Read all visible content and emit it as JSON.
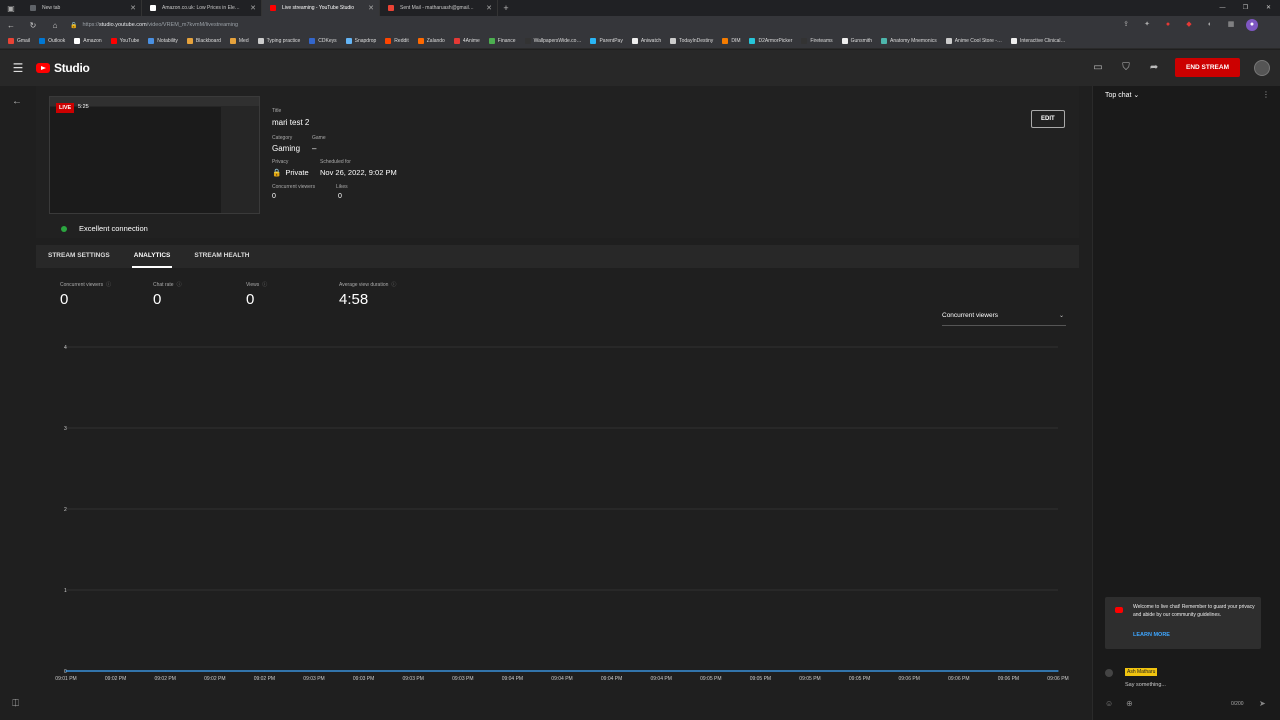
{
  "browser": {
    "tabs": [
      {
        "label": "New tab",
        "color": "#5f6368"
      },
      {
        "label": "Amazon.co.uk: Low Prices in Ele…",
        "color": "#ffffff"
      },
      {
        "label": "Live streaming - YouTube Studio",
        "color": "#ff0000"
      },
      {
        "label": "Sent Mail - matharuash@gmail…",
        "color": "#ea4335"
      }
    ],
    "active_tab": 2,
    "url_host": "studio.youtube.com",
    "url_prefix": "https://",
    "url_path": "/video/VREM_m7kvmM/livestreaming",
    "bookmarks": [
      {
        "label": "Gmail",
        "color": "#ea4335"
      },
      {
        "label": "Outlook",
        "color": "#0078d4"
      },
      {
        "label": "Amazon",
        "color": "#ffffff"
      },
      {
        "label": "YouTube",
        "color": "#ff0000"
      },
      {
        "label": "Notability",
        "color": "#4a90e2"
      },
      {
        "label": "Blackboard",
        "color": "#e6a23c"
      },
      {
        "label": "Med",
        "color": "#e6a23c"
      },
      {
        "label": "Typing practice",
        "color": "#cccccc"
      },
      {
        "label": "CDKeys",
        "color": "#3366cc"
      },
      {
        "label": "Snapdrop",
        "color": "#64b5f6"
      },
      {
        "label": "Reddit",
        "color": "#ff4500"
      },
      {
        "label": "Zalando",
        "color": "#ff6900"
      },
      {
        "label": "4Anime",
        "color": "#e53935"
      },
      {
        "label": "Finance",
        "color": "#4caf50"
      },
      {
        "label": "WallpapersWide.co…",
        "color": "#333333"
      },
      {
        "label": "ParentPay",
        "color": "#29b6f6"
      },
      {
        "label": "Aniwatch",
        "color": "#eeeeee"
      },
      {
        "label": "TodayInDestiny",
        "color": "#cccccc"
      },
      {
        "label": "DIM",
        "color": "#f57c00"
      },
      {
        "label": "D2ArmorPicker",
        "color": "#26c6da"
      },
      {
        "label": "Fireteams",
        "color": "#333333"
      },
      {
        "label": "Gunsmith",
        "color": "#eeeeee"
      },
      {
        "label": "Anatomy Mnemonics",
        "color": "#4db6ac"
      },
      {
        "label": "Anime Cool Store -…",
        "color": "#cccccc"
      },
      {
        "label": "Interactive Clinical…",
        "color": "#eeeeee"
      }
    ]
  },
  "header": {
    "brand": "Studio",
    "end_stream": "END STREAM"
  },
  "video": {
    "live": "LIVE",
    "live_time": "5:25",
    "title_label": "Title",
    "title": "mari test 2",
    "category_label": "Category",
    "category": "Gaming",
    "game_label": "Game",
    "game": "–",
    "privacy_label": "Privacy",
    "privacy": "Private",
    "scheduled_label": "Scheduled for",
    "scheduled": "Nov 26, 2022, 9:02 PM",
    "viewers_label": "Concurrent viewers",
    "viewers": "0",
    "likes_label": "Likes",
    "likes": "0",
    "edit": "EDIT",
    "connection": "Excellent connection",
    "connection_color": "#2ba640"
  },
  "tabs": [
    "STREAM SETTINGS",
    "ANALYTICS",
    "STREAM HEALTH"
  ],
  "active_tab": 1,
  "metrics": [
    {
      "label": "Concurrent viewers",
      "value": "0"
    },
    {
      "label": "Chat rate",
      "value": "0"
    },
    {
      "label": "Views",
      "value": "0"
    },
    {
      "label": "Average view duration",
      "value": "4:58"
    }
  ],
  "metric_selector": "Concurrent viewers",
  "chart_data": {
    "type": "line",
    "x": [
      "09:01 PM",
      "09:02 PM",
      "09:02 PM",
      "09:02 PM",
      "09:02 PM",
      "09:03 PM",
      "09:03 PM",
      "09:03 PM",
      "09:03 PM",
      "09:04 PM",
      "09:04 PM",
      "09:04 PM",
      "09:04 PM",
      "09:05 PM",
      "09:05 PM",
      "09:05 PM",
      "09:05 PM",
      "09:06 PM",
      "09:06 PM",
      "09:06 PM",
      "09:06 PM"
    ],
    "series": [
      {
        "values": [
          0,
          0,
          0,
          0,
          0,
          0,
          0,
          0,
          0,
          0,
          0,
          0,
          0,
          0,
          0,
          0,
          0,
          0,
          0,
          0,
          0
        ]
      }
    ],
    "yticks": [
      0,
      1,
      2,
      3,
      4
    ],
    "ylim": [
      0,
      4
    ],
    "grid": true,
    "line_color": "#3ea6ff"
  },
  "chat": {
    "header": "Top chat",
    "welcome": "Welcome to live chat! Remember to guard your privacy and abide by our community guidelines.",
    "learn_more": "LEARN MORE",
    "user": "Ash Matharu",
    "placeholder": "Say something...",
    "count": "0/200"
  }
}
